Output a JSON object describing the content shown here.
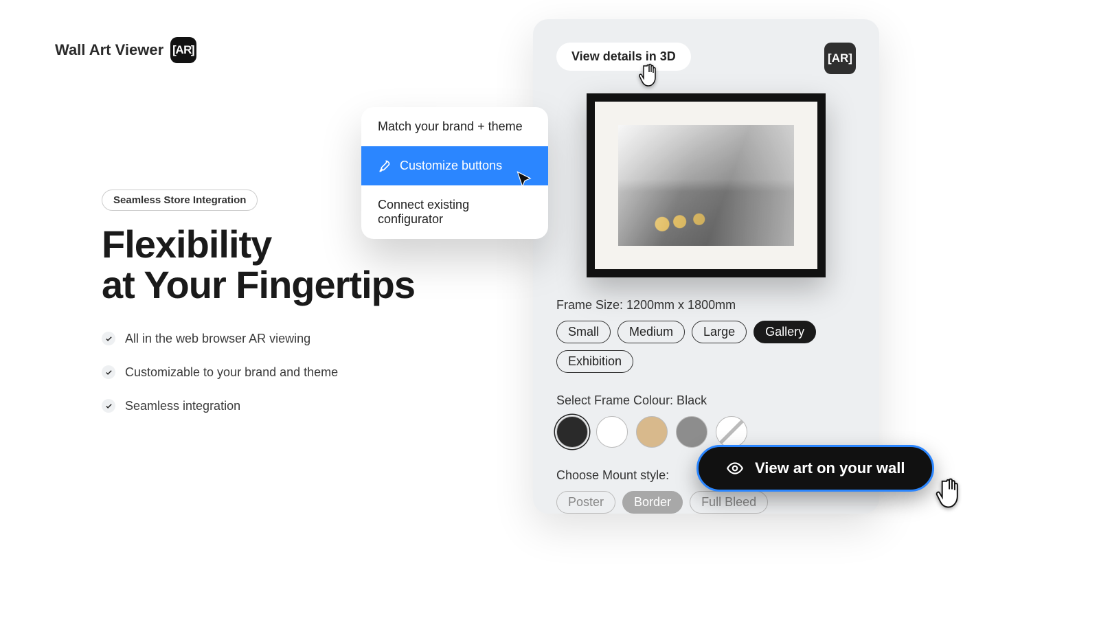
{
  "logo": {
    "text": "Wall Art Viewer",
    "badge": "AR"
  },
  "eyebrow": "Seamless Store Integration",
  "heading_l1": "Flexibility",
  "heading_l2": "at Your Fingertips",
  "features": [
    "All in the web browser AR viewing",
    "Customizable to your brand and theme",
    "Seamless integration"
  ],
  "dropdown": {
    "items": [
      "Match your brand + theme",
      "Customize buttons",
      "Connect existing configurator"
    ],
    "selected_index": 1
  },
  "mock": {
    "view3d_label": "View details in 3D",
    "ar_mini": "AR",
    "frame_size_label": "Frame Size: 1200mm x 1800mm",
    "sizes": [
      "Small",
      "Medium",
      "Large",
      "Gallery",
      "Exhibition"
    ],
    "size_selected": "Gallery",
    "colour_label": "Select Frame Colour: Black",
    "mount_label": "Choose Mount style:",
    "mounts": [
      "Poster",
      "Border",
      "Full Bleed"
    ],
    "mount_selected": "Border"
  },
  "cta": "View art on your wall"
}
